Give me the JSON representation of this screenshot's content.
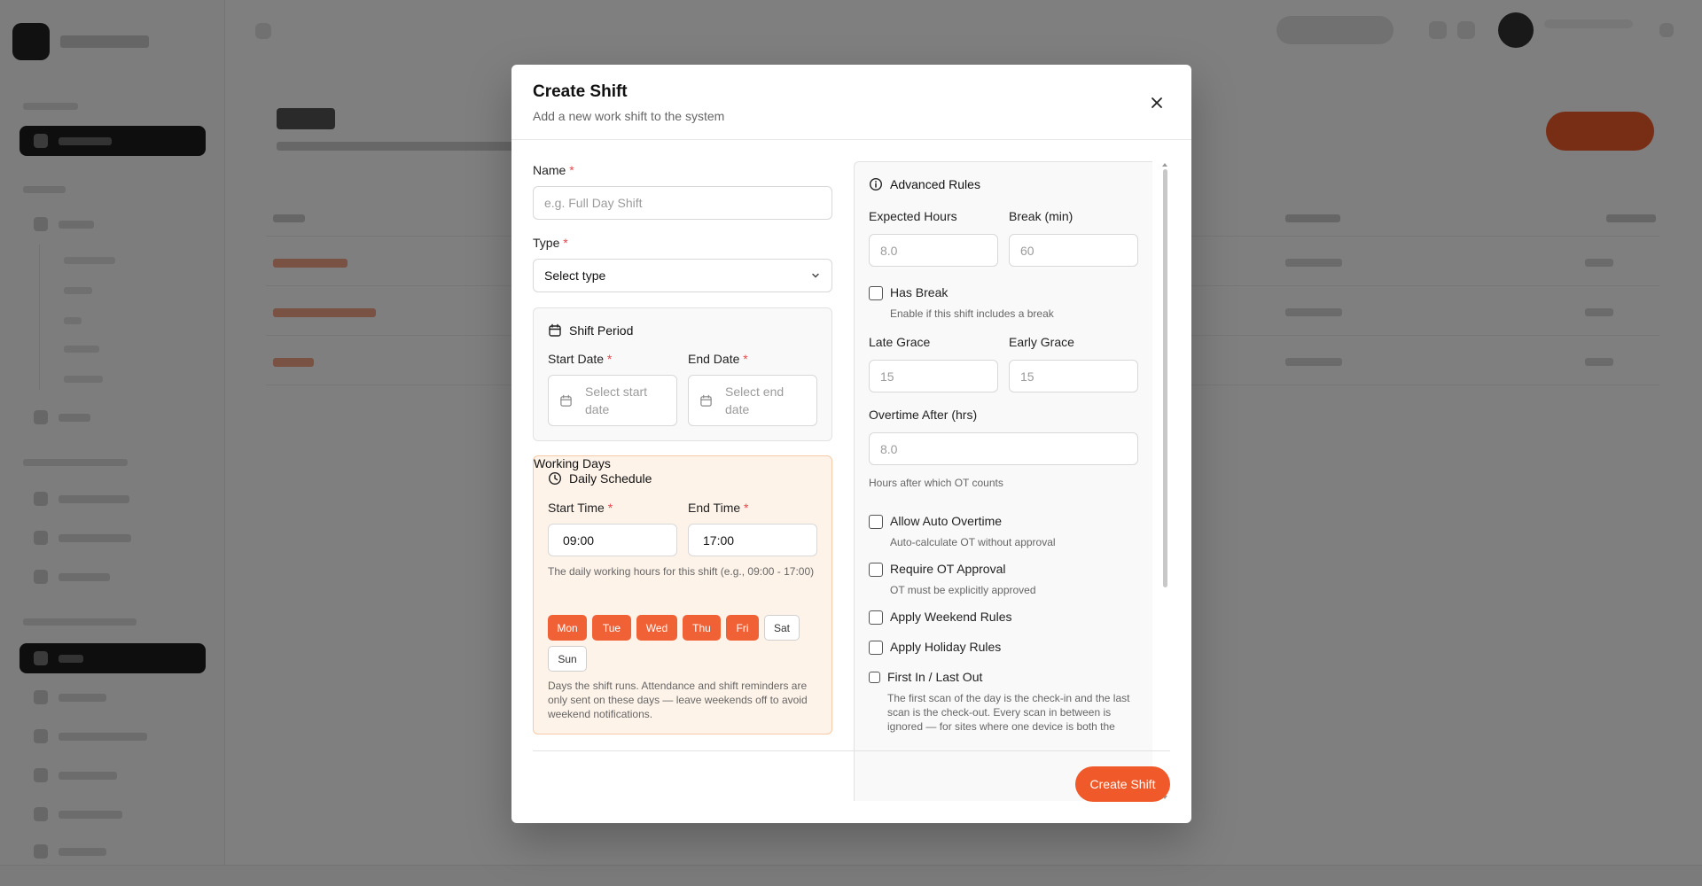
{
  "modal": {
    "title": "Create Shift",
    "subtitle": "Add a new work shift to the system",
    "close_icon": "close-icon"
  },
  "form": {
    "name": {
      "label": "Name",
      "required_mark": "*",
      "placeholder": "e.g. Full Day Shift",
      "value": ""
    },
    "type": {
      "label": "Type",
      "required_mark": "*",
      "selected": "Select type"
    },
    "shift_period": {
      "title": "Shift Period",
      "icon": "calendar-icon",
      "start_date": {
        "label": "Start Date",
        "required_mark": "*",
        "placeholder": "Select start date"
      },
      "end_date": {
        "label": "End Date",
        "required_mark": "*",
        "placeholder": "Select end date"
      }
    },
    "daily_schedule": {
      "title": "Daily Schedule",
      "icon": "clock-icon",
      "start_time": {
        "label": "Start Time",
        "required_mark": "*",
        "value": "09:00"
      },
      "end_time": {
        "label": "End Time",
        "required_mark": "*",
        "value": "17:00"
      },
      "help": "The daily working hours for this shift (e.g., 09:00 - 17:00)",
      "working_days": {
        "label": "Working Days",
        "days": [
          {
            "label": "Mon",
            "selected": true
          },
          {
            "label": "Tue",
            "selected": true
          },
          {
            "label": "Wed",
            "selected": true
          },
          {
            "label": "Thu",
            "selected": true
          },
          {
            "label": "Fri",
            "selected": true
          },
          {
            "label": "Sat",
            "selected": false
          },
          {
            "label": "Sun",
            "selected": false
          }
        ],
        "help": "Days the shift runs. Attendance and shift reminders are only sent on these days — leave weekends off to avoid weekend notifications."
      }
    },
    "advanced_rules": {
      "title": "Advanced Rules",
      "icon": "info-icon",
      "expected_hours": {
        "label": "Expected Hours",
        "placeholder": "8.0"
      },
      "break_min": {
        "label": "Break (min)",
        "placeholder": "60"
      },
      "has_break": {
        "label": "Has Break",
        "help": "Enable if this shift includes a break",
        "checked": false
      },
      "late_grace": {
        "label": "Late Grace",
        "placeholder": "15"
      },
      "early_grace": {
        "label": "Early Grace",
        "placeholder": "15"
      },
      "overtime_after": {
        "label": "Overtime After (hrs)",
        "placeholder": "8.0",
        "help": "Hours after which OT counts"
      },
      "allow_auto_overtime": {
        "label": "Allow Auto Overtime",
        "help": "Auto-calculate OT without approval",
        "checked": false
      },
      "require_ot_approval": {
        "label": "Require OT Approval",
        "help": "OT must be explicitly approved",
        "checked": false
      },
      "apply_weekend_rules": {
        "label": "Apply Weekend Rules",
        "checked": false
      },
      "apply_holiday_rules": {
        "label": "Apply Holiday Rules",
        "checked": false
      },
      "first_in_last_out": {
        "label": "First In / Last Out",
        "help": "The first scan of the day is the check-in and the last scan is the check-out. Every scan in between is ignored — for sites where one device is both the",
        "checked": false
      }
    }
  },
  "footer": {
    "submit_label": "Create Shift"
  },
  "colors": {
    "accent": "#f05a2a",
    "schedule_bg": "#fef3e9",
    "required": "#e5484d"
  }
}
